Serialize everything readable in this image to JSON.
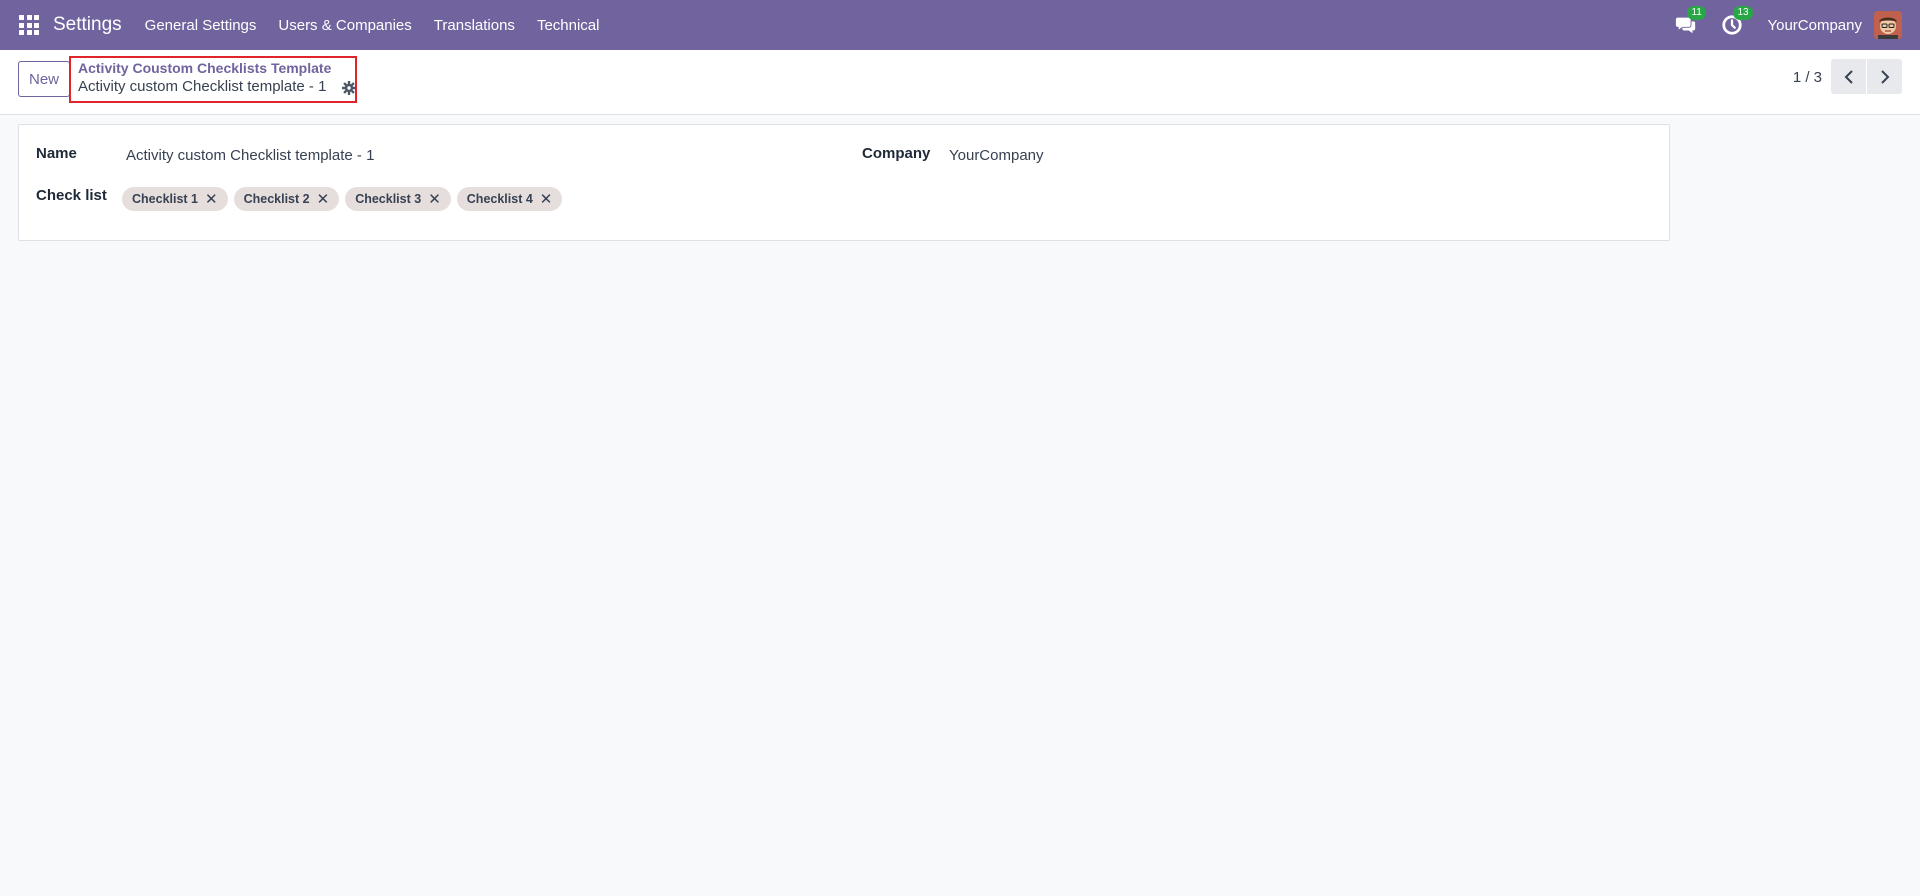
{
  "navbar": {
    "app_title": "Settings",
    "menu": [
      "General Settings",
      "Users & Companies",
      "Translations",
      "Technical"
    ],
    "messages_count": "11",
    "activities_count": "13",
    "company": "YourCompany",
    "bg_color": "#71639e",
    "badge_color": "#28a745"
  },
  "control_panel": {
    "new_label": "New",
    "breadcrumb_parent": "Activity Coustom Checklists Template",
    "breadcrumb_current": "Activity custom Checklist template - 1",
    "pager": "1 / 3"
  },
  "form": {
    "name_label": "Name",
    "name_value": "Activity custom Checklist template - 1",
    "company_label": "Company",
    "company_value": "YourCompany",
    "checklist_label": "Check list",
    "checklist_tags": [
      "Checklist 1",
      "Checklist 2",
      "Checklist 3",
      "Checklist 4"
    ]
  }
}
